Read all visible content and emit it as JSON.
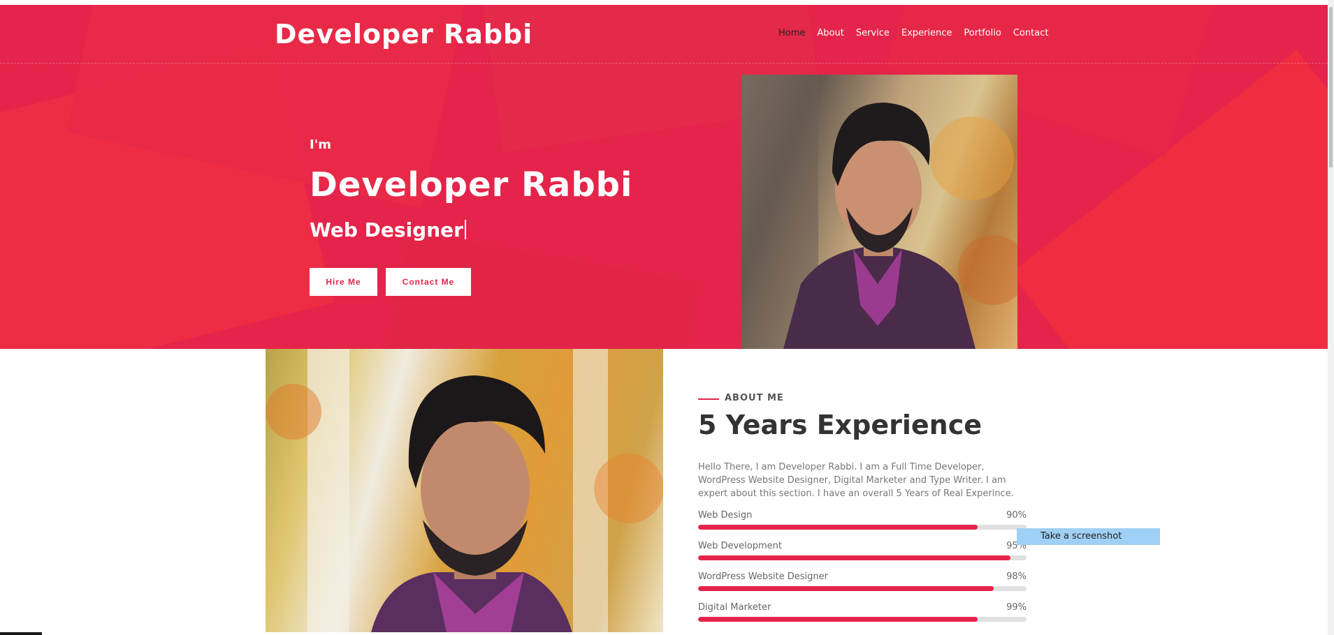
{
  "header": {
    "logo": "Developer Rabbi",
    "nav": [
      {
        "label": "Home",
        "active": true
      },
      {
        "label": "About"
      },
      {
        "label": "Service"
      },
      {
        "label": "Experience"
      },
      {
        "label": "Portfolio"
      },
      {
        "label": "Contact"
      }
    ]
  },
  "hero": {
    "intro": "I'm",
    "name": "Developer Rabbi",
    "role": "Web Designer",
    "buttons": {
      "hire": "Hire Me",
      "contact": "Contact Me"
    }
  },
  "about": {
    "label": "ABOUT ME",
    "title": "5 Years Experience",
    "text": "Hello There, I am Developer Rabbi. I am a Full Time Developer, WordPress Website Designer, Digital Marketer and Type Writer. I am expert about this section. I have an overall 5 Years of Real Experince.",
    "skills": [
      {
        "name": "Web Design",
        "percent": "90%",
        "value": 0.85
      },
      {
        "name": "Web Development",
        "percent": "95%",
        "value": 0.95
      },
      {
        "name": "WordPress Website Designer",
        "percent": "98%",
        "value": 0.9
      },
      {
        "name": "Digital Marketer",
        "percent": "99%",
        "value": 0.85
      }
    ]
  },
  "tooltip": {
    "label": "Take a screenshot"
  },
  "colors": {
    "accent": "#e4244a",
    "dark": "#333333"
  }
}
